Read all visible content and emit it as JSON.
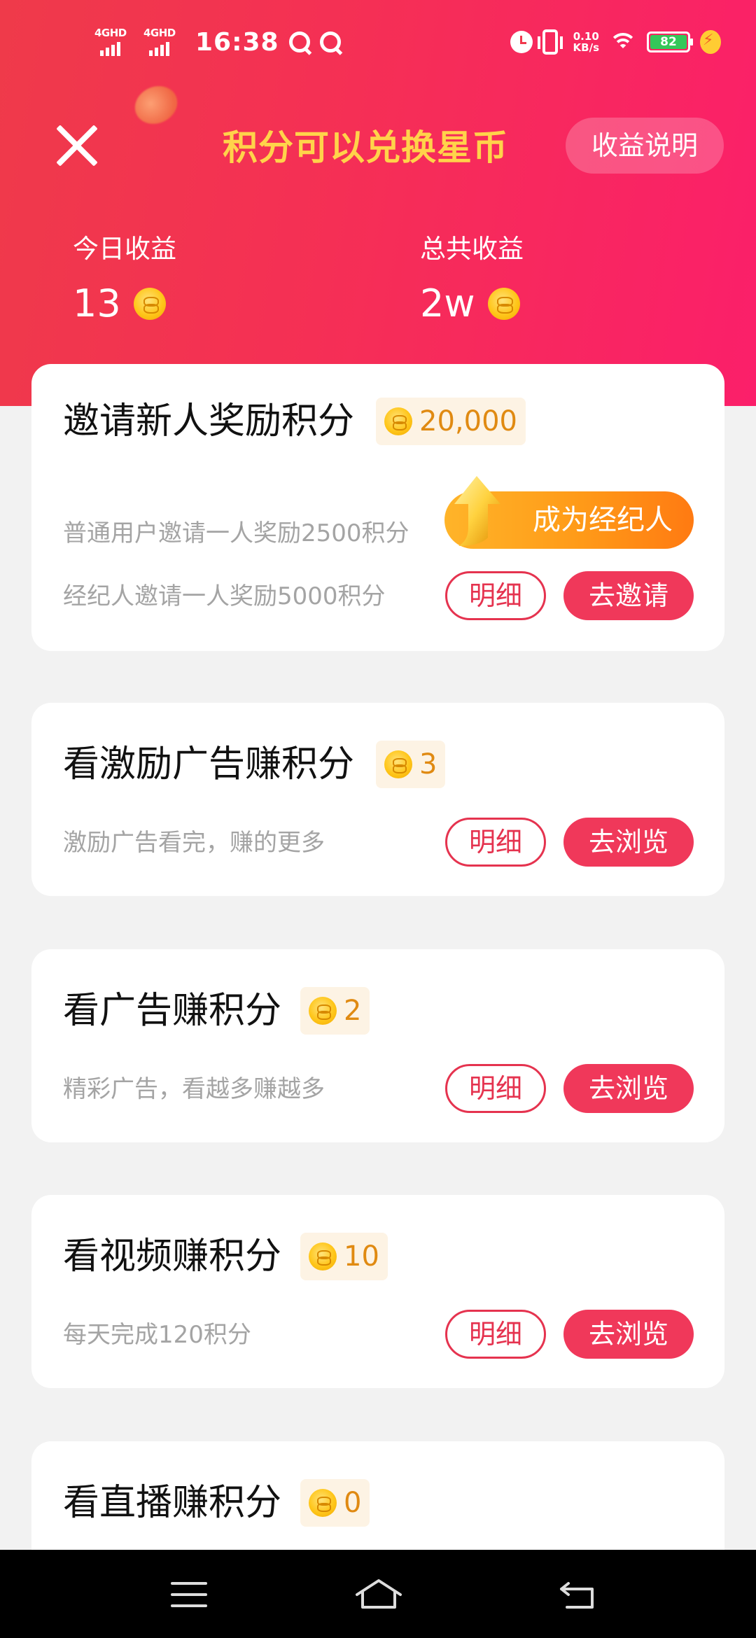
{
  "status_bar": {
    "net1": "4GHD",
    "net2": "4GHD",
    "time": "16:38",
    "speed_value": "0.10",
    "speed_unit": "KB/s",
    "battery": "82"
  },
  "header": {
    "title": "积分可以兑换星币",
    "explain_button": "收益说明",
    "today_label": "今日收益",
    "today_value": "13",
    "total_label": "总共收益",
    "total_value": "2w"
  },
  "cards": [
    {
      "title": "邀请新人奖励积分",
      "points": "20,000",
      "desc1": "普通用户邀请一人奖励2500积分",
      "desc2": "经纪人邀请一人奖励5000积分",
      "agent_button": "成为经纪人",
      "detail_button": "明细",
      "action_button": "去邀请"
    },
    {
      "title": "看激励广告赚积分",
      "points": "3",
      "desc": "激励广告看完，赚的更多",
      "detail_button": "明细",
      "action_button": "去浏览"
    },
    {
      "title": "看广告赚积分",
      "points": "2",
      "desc": "精彩广告，看越多赚越多",
      "detail_button": "明细",
      "action_button": "去浏览"
    },
    {
      "title": "看视频赚积分",
      "points": "10",
      "desc": "每天完成120积分",
      "detail_button": "明细",
      "action_button": "去浏览"
    },
    {
      "title": "看直播赚积分",
      "points": "0"
    }
  ],
  "colors": {
    "header_gradient_start": "#ef3a4a",
    "header_gradient_end": "#fb1f6a",
    "title_yellow": "#ffd34a",
    "accent_red": "#f0385a",
    "badge_bg": "#fdf3e4",
    "badge_text": "#e08a12"
  },
  "icons": {
    "close": "close-icon",
    "coin": "coin-icon",
    "nav_menu": "menu-icon",
    "nav_home": "home-icon",
    "nav_back": "back-icon"
  }
}
